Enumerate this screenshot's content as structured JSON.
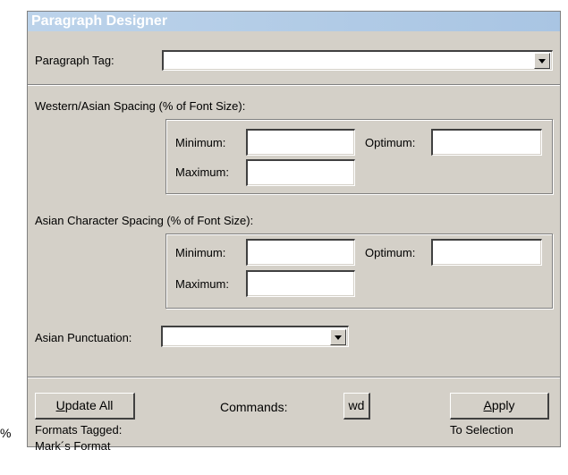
{
  "window": {
    "title": "Paragraph Designer"
  },
  "stray_text": "%",
  "paragraph_tag": {
    "label": "Paragraph Tag:",
    "value": ""
  },
  "western": {
    "heading": "Western/Asian Spacing (% of Font Size):",
    "minimum_label": "Minimum:",
    "minimum_value": "",
    "optimum_label": "Optimum:",
    "optimum_value": "",
    "maximum_label": "Maximum:",
    "maximum_value": ""
  },
  "asian_char": {
    "heading": "Asian Character Spacing (% of Font Size):",
    "minimum_label": "Minimum:",
    "minimum_value": "",
    "optimum_label": "Optimum:",
    "optimum_value": "",
    "maximum_label": "Maximum:",
    "maximum_value": ""
  },
  "asian_punct": {
    "label": "Asian Punctuation:",
    "value": ""
  },
  "footer": {
    "update_all": {
      "u": "U",
      "rest": "pdate All"
    },
    "commands_label": "Commands:",
    "commands_button": "wd",
    "apply": {
      "u": "A",
      "rest": "pply"
    },
    "formats_tagged": "Formats Tagged:",
    "format_name": "Mark´s Format",
    "to_selection": "To Selection"
  },
  "icons": [
    "chevron-down-icon"
  ]
}
